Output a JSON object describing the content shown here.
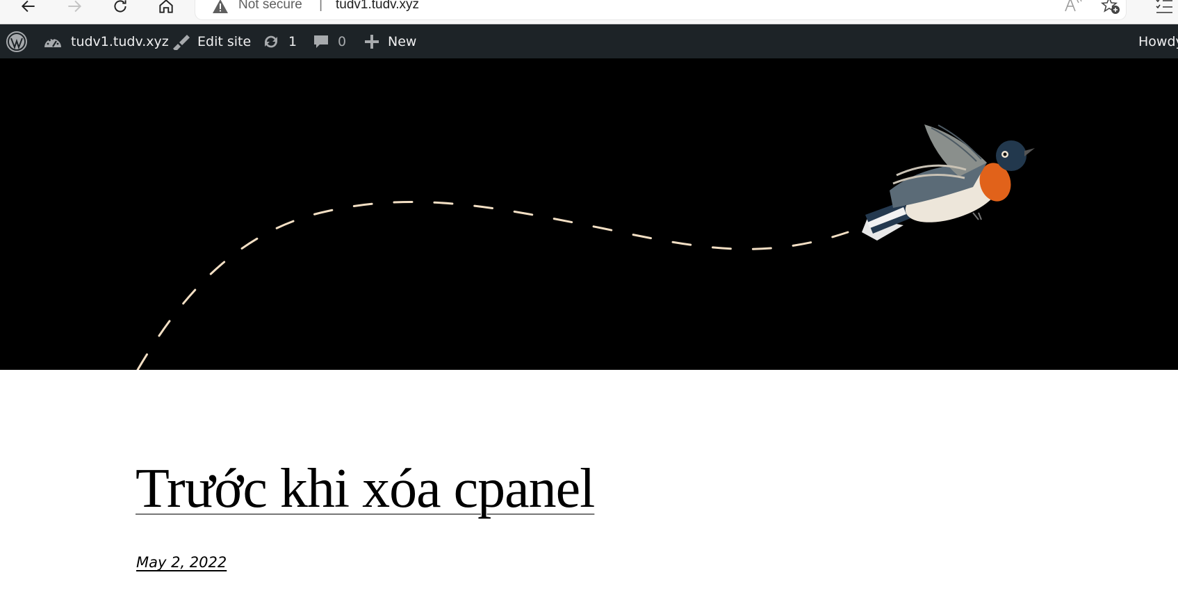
{
  "browser": {
    "security_label": "Not secure",
    "separator": "|",
    "url": "tudv1.tudv.xyz",
    "icons": [
      "back-arrow-icon",
      "forward-arrow-icon",
      "refresh-icon",
      "home-icon",
      "warning-icon",
      "read-aloud-icon",
      "favorites-add-icon",
      "collections-icon"
    ]
  },
  "admin_bar": {
    "site_name": "tudv1.tudv.xyz",
    "edit_site": "Edit site",
    "updates_count": "1",
    "comments_count": "0",
    "new_label": "New",
    "howdy": "Howdy",
    "icons": [
      "wordpress-logo-icon",
      "dashboard-icon",
      "brush-icon",
      "updates-icon",
      "comment-icon",
      "plus-icon"
    ]
  },
  "hero": {
    "background": "#000000",
    "path_color": "#f3dfc4",
    "image": "bird-illustration"
  },
  "post": {
    "title": "Trước khi xóa cpanel",
    "date": "May 2, 2022"
  }
}
